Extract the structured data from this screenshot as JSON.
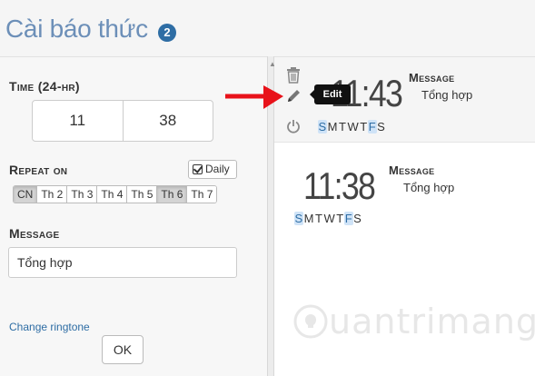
{
  "app": {
    "title": "Cài báo thức",
    "alarm_count": "2"
  },
  "form": {
    "time_label": "Time (24-hr)",
    "hour": "11",
    "minute": "38",
    "repeat_label": "Repeat on",
    "daily_label": "Daily",
    "days": [
      {
        "label": "CN",
        "on": true
      },
      {
        "label": "Th 2",
        "on": false
      },
      {
        "label": "Th 3",
        "on": false
      },
      {
        "label": "Th 4",
        "on": false
      },
      {
        "label": "Th 5",
        "on": false
      },
      {
        "label": "Th 6",
        "on": true
      },
      {
        "label": "Th 7",
        "on": false
      }
    ],
    "message_label": "Message",
    "message_value": "Tổng hợp",
    "change_ringtone": "Change ringtone",
    "ok_label": "OK"
  },
  "alarms": [
    {
      "time": "11:43",
      "message_label": "Message",
      "message": "Tổng hợp",
      "weekdays": [
        {
          "d": "S",
          "hl": true
        },
        {
          "d": "M",
          "hl": false
        },
        {
          "d": "T",
          "hl": false
        },
        {
          "d": "W",
          "hl": false
        },
        {
          "d": "T",
          "hl": false
        },
        {
          "d": "F",
          "hl": true
        },
        {
          "d": "S",
          "hl": false
        }
      ]
    },
    {
      "time": "11:38",
      "message_label": "Message",
      "message": "Tổng hợp",
      "weekdays": [
        {
          "d": "S",
          "hl": true
        },
        {
          "d": "M",
          "hl": false
        },
        {
          "d": "T",
          "hl": false
        },
        {
          "d": "W",
          "hl": false
        },
        {
          "d": "T",
          "hl": false
        },
        {
          "d": "F",
          "hl": true
        },
        {
          "d": "S",
          "hl": false
        }
      ]
    }
  ],
  "tooltip": {
    "edit": "Edit"
  },
  "icons": {
    "delete": "trash-icon",
    "edit": "pencil-icon",
    "power": "power-icon",
    "check": "check-icon",
    "pointer": "red-arrow-icon",
    "logo": "bulb-logo-icon"
  },
  "watermark": {
    "text": "uantrimang"
  },
  "colors": {
    "title": "#6c8fb8",
    "badge": "#2e6da4",
    "highlight": "#cfe3f7",
    "arrow": "#e8121a"
  }
}
